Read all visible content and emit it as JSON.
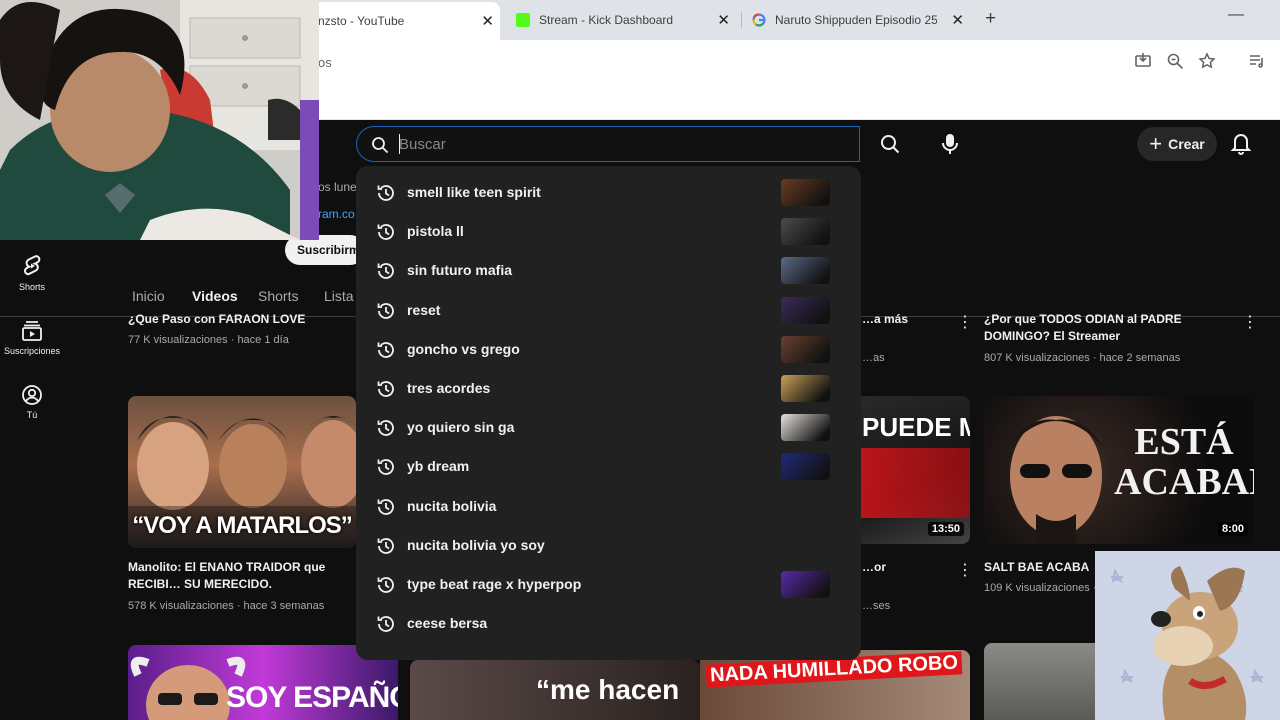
{
  "browser": {
    "tabs": [
      {
        "title": "nzsto - YouTube",
        "active": true
      },
      {
        "title": "Stream - Kick Dashboard",
        "active": false
      },
      {
        "title": "Naruto Shippuden Episodio 25:",
        "active": false
      }
    ],
    "new_tab": "+",
    "close_glyph": "✕",
    "minimize": "—",
    "url_fragment": "os"
  },
  "nav": {
    "items": [
      {
        "label": "Shorts",
        "icon": "shorts-icon"
      },
      {
        "label": "Suscripciones",
        "icon": "subscriptions-icon"
      },
      {
        "label": "Tú",
        "icon": "you-icon"
      }
    ]
  },
  "header": {
    "search_placeholder": "Buscar",
    "create_label": "Crear"
  },
  "channel": {
    "desc_fragment": "os lune",
    "link_fragment": "ram.co",
    "subscribe_label": "Suscribirme",
    "tabs": [
      "Inicio",
      "Videos",
      "Shorts",
      "Lista"
    ]
  },
  "suggestions": [
    {
      "text": "smell like teen spirit",
      "thumb": true
    },
    {
      "text": "pistola ll",
      "thumb": true
    },
    {
      "text": "sin futuro mafia",
      "thumb": true
    },
    {
      "text": "reset",
      "thumb": true
    },
    {
      "text": "goncho vs grego",
      "thumb": true
    },
    {
      "text": "tres acordes",
      "thumb": true
    },
    {
      "text": "yo quiero sin ga",
      "thumb": true
    },
    {
      "text": "yb dream",
      "thumb": true
    },
    {
      "text": "nucita bolivia",
      "thumb": false
    },
    {
      "text": "nucita bolivia yo soy",
      "thumb": false
    },
    {
      "text": "type beat rage x hyperpop",
      "thumb": true
    },
    {
      "text": "ceese bersa",
      "thumb": false
    }
  ],
  "videos": {
    "row1": [
      {
        "title": "¿Que Paso con FARAON LOVE SHADY?",
        "meta": "77 K visualizaciones · hace 1 día"
      },
      {
        "title": "…a más",
        "meta": "…as"
      },
      {
        "title": "¿Por que TODOS ODIAN al PADRE DOMINGO? El Streamer MALAGRADECIDO",
        "meta": "807 K visualizaciones · hace 2 semanas"
      }
    ],
    "row2": [
      {
        "thumb_text": "“VOY A MATARLOS”",
        "title": "Manolito: El ENANO TRAIDOR que RECIBI… SU MERECIDO.",
        "meta": "578 K visualizaciones · hace 3 semanas"
      },
      {
        "thumb_text": "PUEDE MÁS",
        "duration": "13:50",
        "title": "…or PSICÓPATA",
        "meta": "…ses"
      },
      {
        "thumb_text": "ESTÁ ACABADO",
        "duration": "8:00",
        "title": "SALT BAE ACABA D…",
        "meta": "109 K visualizaciones · …"
      }
    ],
    "row3": [
      {
        "thumb_text": "SOY ESPAÑOL"
      },
      {
        "thumb_text": "“me hacen"
      },
      {
        "thumb_text": "NADA HUMILLADO ROBO"
      }
    ]
  },
  "colors": {
    "yt_bg": "#0f0f0f",
    "dropdown_bg": "#212121",
    "search_border": "#1c62b9",
    "accent_red": "#e0161b",
    "accent_yellow": "#ffe400",
    "link_blue": "#3ea6ff"
  }
}
